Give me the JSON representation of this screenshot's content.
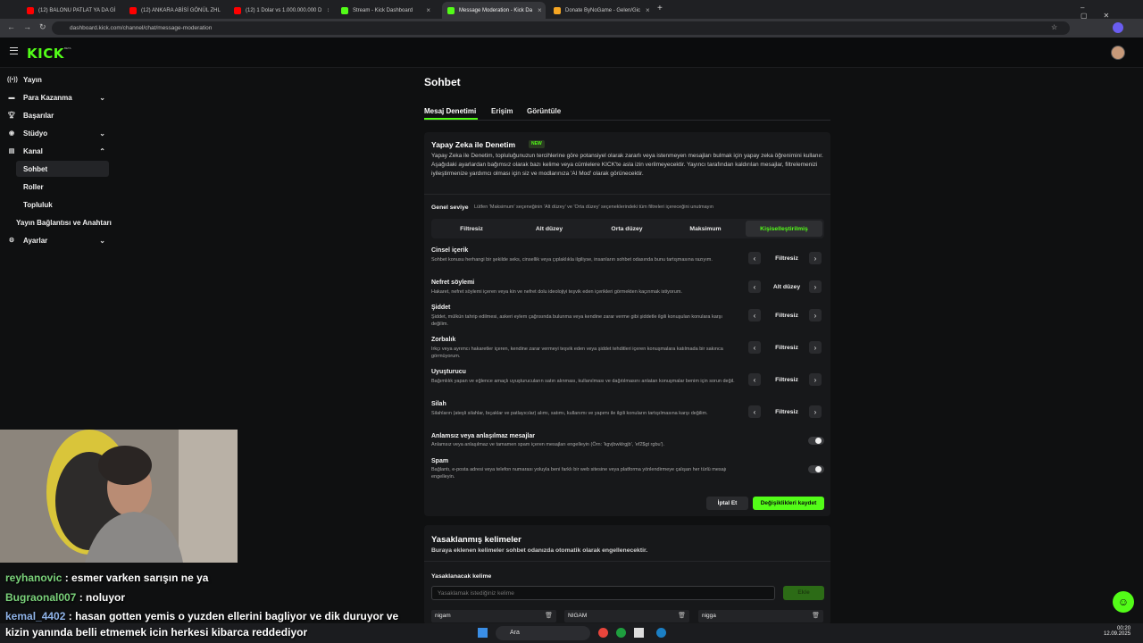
{
  "browser": {
    "tabs": [
      {
        "title": "(12) BALONU PATLAT YA DA Gİ",
        "color": "#ff0000"
      },
      {
        "title": "(12) ANKARA ABİSİ GÖNÜL ZHL",
        "color": "#ff0000"
      },
      {
        "title": "(12) 1 Dolar vs 1.000.000.000 D",
        "color": "#ff0000"
      },
      {
        "title": "Stream - Kick Dashboard",
        "color": "#53fc18"
      },
      {
        "title": "Message Moderation - Kick Da",
        "color": "#53fc18"
      },
      {
        "title": "Donate ByNoGame - Gelen/Gic",
        "color": "#f5a623"
      }
    ],
    "url": "dashboard.kick.com/channel/chat/message-moderation"
  },
  "header": {
    "logo": "KICK",
    "beta": "BETA"
  },
  "sidebar": {
    "items": [
      {
        "label": "Yayın",
        "icon": "broadcast-icon"
      },
      {
        "label": "Para Kazanma",
        "icon": "money-icon"
      },
      {
        "label": "Başarılar",
        "icon": "trophy-icon"
      },
      {
        "label": "Stüdyo",
        "icon": "studio-icon"
      },
      {
        "label": "Kanal",
        "icon": "channel-icon"
      },
      {
        "label": "Sohbet"
      },
      {
        "label": "Roller"
      },
      {
        "label": "Topluluk"
      },
      {
        "label": "Yayın Bağlantısı ve Anahtarı"
      },
      {
        "label": "Ayarlar",
        "icon": "gear-icon"
      }
    ]
  },
  "page": {
    "title": "Sohbet",
    "tabs": [
      "Mesaj Denetimi",
      "Erişim",
      "Görüntüle"
    ]
  },
  "ai": {
    "title": "Yapay Zeka ile Denetim",
    "badge": "NEW",
    "description": "Yapay Zeka ile Denetim, topluluğunuzun tercihlerine göre potansiyel olarak zararlı veya istenmeyen mesajları bulmak için yapay zeka öğrenimini kullanır. Aşağıdaki ayarlardan bağımsız olarak bazı kelime veya cümlelere KICK'te asla izin verilmeyecektir. Yayıncı tarafından kaldırılan mesajlar, filtrelemenizi iyileştirmenize yardımcı olması için siz ve modlarınıza 'AI Mod' olarak görünecektir.",
    "general_label": "Genel seviye",
    "general_hint": "Lütfen 'Maksimum' seçeneğinin 'Alt düzey' ve 'Orta düzey' seçeneklerindeki tüm filtreleri içereceğini unutmayın",
    "levels": [
      "Filtresiz",
      "Alt düzey",
      "Orta düzey",
      "Maksimum",
      "Kişiselleştirilmiş"
    ],
    "categories": [
      {
        "title": "Cinsel içerik",
        "desc": "Sohbet konusu herhangi bir şekilde seks, cinsellik veya çıplaklıkla ilgiliyse, insanların sohbet odasında bunu tartışmasına razıyım.",
        "value": "Filtresiz"
      },
      {
        "title": "Nefret söylemi",
        "desc": "Hakaret, nefret söylemi içeren veya kin ve nefret dolu ideolojiyi teşvik eden içerikleri görmekten kaçınmak istiyorum.",
        "value": "Alt düzey"
      },
      {
        "title": "Şiddet",
        "desc": "Şiddet, mülkün tahrip edilmesi, askeri eylem çağrısında bulunma veya kendine zarar verme gibi şiddetle ilgili konuşulan konulara karşı değilim.",
        "value": "Filtresiz"
      },
      {
        "title": "Zorbalık",
        "desc": "Irkçı veya ayrımcı hakaretler içeren, kendine zarar vermeyi teşvik eden veya şiddet tehditleri içeren konuşmalara katılmada bir sakınca görmüyorum.",
        "value": "Filtresiz"
      },
      {
        "title": "Uyuşturucu",
        "desc": "Bağımlılık yapan ve eğlence amaçlı uyuşturucuların satın alınması, kullanılması ve dağıtılmasını anlatan konuşmalar benim için sorun değil.",
        "value": "Filtresiz"
      },
      {
        "title": "Silah",
        "desc": "Silahların (ateşli silahlar, bıçaklar ve patlayıcılar) alımı, satımı, kullanımı ve yapımı ile ilgili konuların tartışılmasına karşı değilim.",
        "value": "Filtresiz"
      }
    ],
    "toggles": [
      {
        "title": "Anlamsız veya anlaşılmaz mesajlar",
        "desc": "Anlamsız veya anlaşılmaz ve tamamen spam içeren mesajları engelleyin (Örn: 'kgvjbwklrgjb', 'ef2$gt rgbu')."
      },
      {
        "title": "Spam",
        "desc": "Bağlantı, e-posta adresi veya telefon numarası yoluyla beni farklı bir web sitesine veya platforma yönlendirmeye çalışan her türlü mesajı engelleyin."
      }
    ],
    "cancel_label": "İptal Et",
    "save_label": "Değişiklikleri kaydet"
  },
  "banned": {
    "title": "Yasaklanmış kelimeler",
    "description": "Buraya eklenen kelimeler sohbet odanızda otomatik olarak engellenecektir.",
    "field_label": "Yasaklanacak kelime",
    "placeholder": "Yasaklamak istediğiniz kelime",
    "add_label": "Ekle",
    "words": [
      "nigam",
      "NIGAM",
      "nigga"
    ]
  },
  "chat_overlay": [
    {
      "user": "reyhanovic",
      "message": ": esmer varken sarışın ne ya"
    },
    {
      "user": "Bugraonal007",
      "message": ": noluyor"
    },
    {
      "user": "kemal_4402",
      "message": ": hasan gotten yemis o yuzden ellerini bagliyor ve dik duruyor ve"
    },
    {
      "user": "",
      "message": "kizin yanında belli etmemek icin herkesi kibarca reddediyor"
    }
  ],
  "taskbar": {
    "search": "Ara",
    "time": "00:20",
    "date": "12.09.2025"
  },
  "colors": {
    "accent": "#53fc18",
    "background": "#0f1011",
    "panel": "#17181a"
  }
}
